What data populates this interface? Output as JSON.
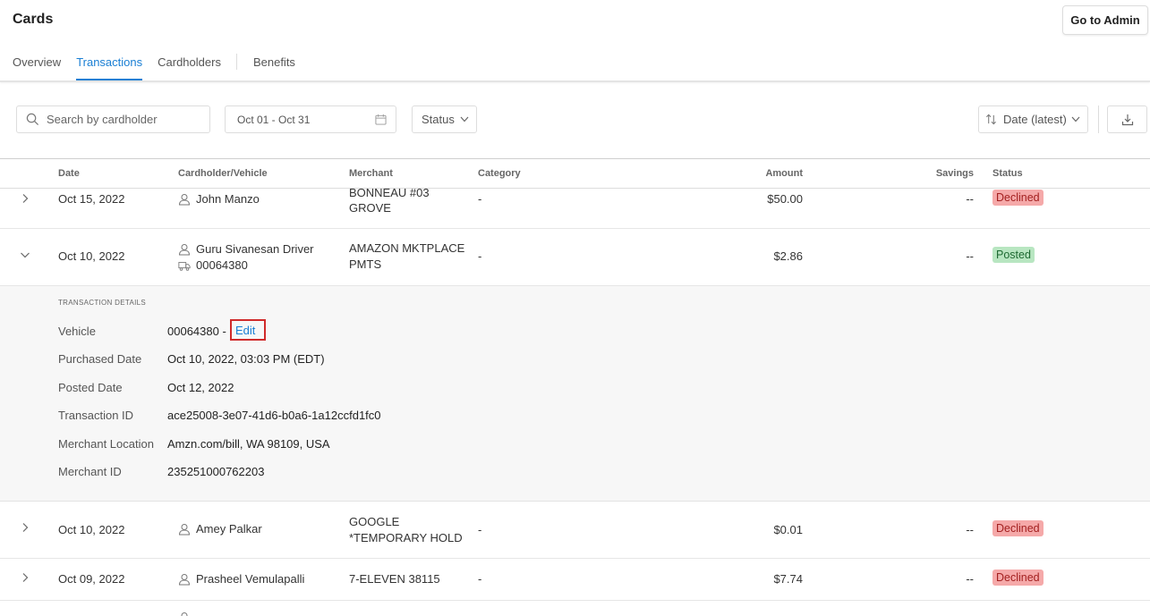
{
  "header": {
    "title": "Cards",
    "admin_button": "Go to Admin",
    "tabs": [
      {
        "label": "Overview",
        "active": false
      },
      {
        "label": "Transactions",
        "active": true
      },
      {
        "label": "Cardholders",
        "active": false
      },
      {
        "label": "Benefits",
        "active": false
      }
    ]
  },
  "toolbar": {
    "search_placeholder": "Search by cardholder",
    "date_range": "Oct 01 - Oct 31",
    "status_filter": "Status",
    "sort": "Date (latest)"
  },
  "columns": {
    "date": "Date",
    "cardholder": "Cardholder/Vehicle",
    "merchant": "Merchant",
    "category": "Category",
    "amount": "Amount",
    "savings": "Savings",
    "status": "Status"
  },
  "rows": [
    {
      "date": "Oct 15, 2022",
      "cardholder": "John Manzo",
      "vehicle": "",
      "merchant_line1": "BONNEAU #03",
      "merchant_line2": "GROVE",
      "category": "-",
      "amount": "$50.00",
      "savings": "--",
      "status": "Declined"
    },
    {
      "date": "Oct 10, 2022",
      "cardholder": "Guru Sivanesan Driver",
      "vehicle": "00064380",
      "merchant_line1": "AMAZON MKTPLACE",
      "merchant_line2": "PMTS",
      "category": "-",
      "amount": "$2.86",
      "savings": "--",
      "status": "Posted"
    },
    {
      "date": "Oct 10, 2022",
      "cardholder": "Amey Palkar",
      "vehicle": "",
      "merchant_line1": "GOOGLE",
      "merchant_line2": "*TEMPORARY HOLD",
      "category": "-",
      "amount": "$0.01",
      "savings": "--",
      "status": "Declined"
    },
    {
      "date": "Oct 09, 2022",
      "cardholder": "Prasheel Vemulapalli",
      "vehicle": "",
      "merchant_line1": "7-ELEVEN 38115",
      "merchant_line2": "",
      "category": "-",
      "amount": "$7.74",
      "savings": "--",
      "status": "Declined"
    }
  ],
  "details": {
    "title": "TRANSACTION DETAILS",
    "vehicle_label": "Vehicle",
    "vehicle_value": "00064380 -",
    "edit_label": "Edit",
    "purchased_label": "Purchased Date",
    "purchased_value": "Oct 10, 2022, 03:03 PM (EDT)",
    "posted_label": "Posted Date",
    "posted_value": "Oct 12, 2022",
    "txn_id_label": "Transaction ID",
    "txn_id_value": "ace25008-3e07-41d6-b0a6-1a12ccfd1fc0",
    "location_label": "Merchant Location",
    "location_value": "Amzn.com/bill, WA 98109, USA",
    "merchant_id_label": "Merchant ID",
    "merchant_id_value": "235251000762203"
  },
  "colors": {
    "accent": "#1a7fd4",
    "declined_bg": "#f5a9a9",
    "posted_bg": "#b8e6c1",
    "highlight": "#d02b2b"
  }
}
